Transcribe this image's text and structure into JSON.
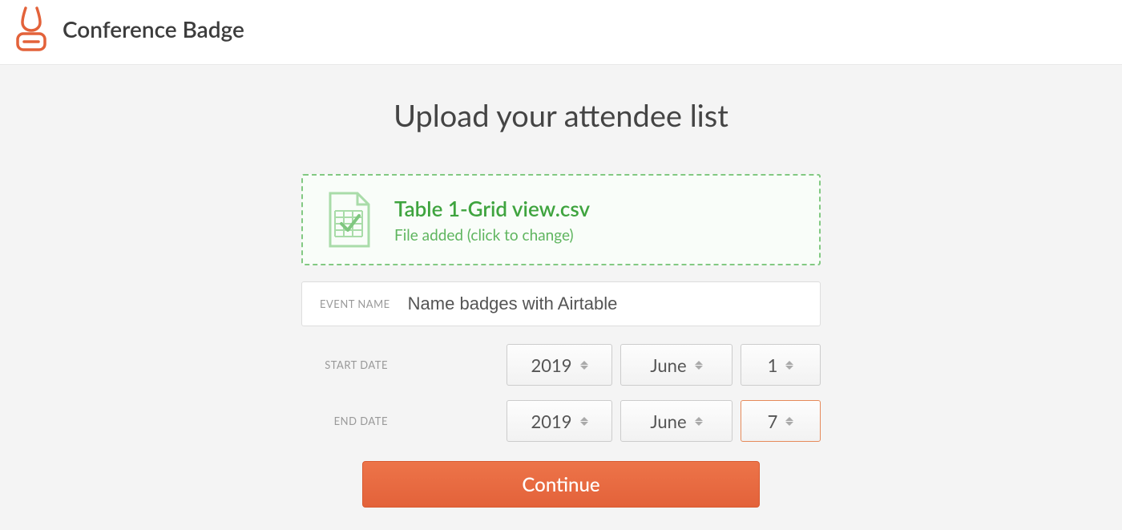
{
  "brand": {
    "name": "Conference Badge"
  },
  "page": {
    "title": "Upload your attendee list"
  },
  "upload": {
    "filename": "Table 1-Grid view.csv",
    "hint": "File added (click to change)"
  },
  "eventName": {
    "label": "EVENT NAME",
    "value": "Name badges with Airtable"
  },
  "startDate": {
    "label": "START DATE",
    "year": "2019",
    "month": "June",
    "day": "1"
  },
  "endDate": {
    "label": "END DATE",
    "year": "2019",
    "month": "June",
    "day": "7"
  },
  "continueLabel": "Continue",
  "colors": {
    "accent": "#e3623a",
    "success": "#3fa43f"
  }
}
